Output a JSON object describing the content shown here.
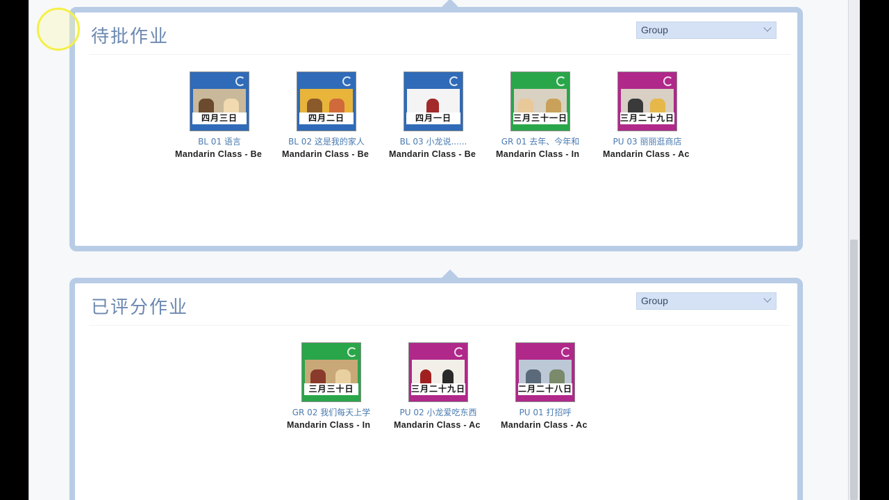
{
  "pending": {
    "title": "待批作业",
    "group_label": "Group",
    "items": [
      {
        "date": "四月三日",
        "title": "BL 01 语言",
        "class": "Mandarin Class - Be",
        "color": "#2f6bb8"
      },
      {
        "date": "四月二日",
        "title": "BL 02 这是我的家人",
        "class": "Mandarin Class - Be",
        "color": "#2f6bb8"
      },
      {
        "date": "四月一日",
        "title": "BL 03 小龙说......",
        "class": "Mandarin Class - Be",
        "color": "#2f6bb8"
      },
      {
        "date": "三月三十一日",
        "title": "GR 01 去年、今年和",
        "class": "Mandarin Class - In",
        "color": "#2aa64a"
      },
      {
        "date": "三月二十九日",
        "title": "PU 03 丽丽逛商店",
        "class": "Mandarin Class - Ac",
        "color": "#b0288a"
      }
    ]
  },
  "graded": {
    "title": "已评分作业",
    "group_label": "Group",
    "items": [
      {
        "date": "三月三十日",
        "title": "GR 02 我们每天上学",
        "class": "Mandarin Class - In",
        "color": "#2aa64a"
      },
      {
        "date": "三月二十九日",
        "title": "PU 02 小龙爱吃东西",
        "class": "Mandarin Class - Ac",
        "color": "#b0288a"
      },
      {
        "date": "二月二十八日",
        "title": "PU 01 打招呼",
        "class": "Mandarin Class - Ac",
        "color": "#b0288a"
      }
    ]
  },
  "colors": {
    "panel_border": "#b8cce6",
    "title": "#6b88b0",
    "link": "#4a7ab0"
  }
}
